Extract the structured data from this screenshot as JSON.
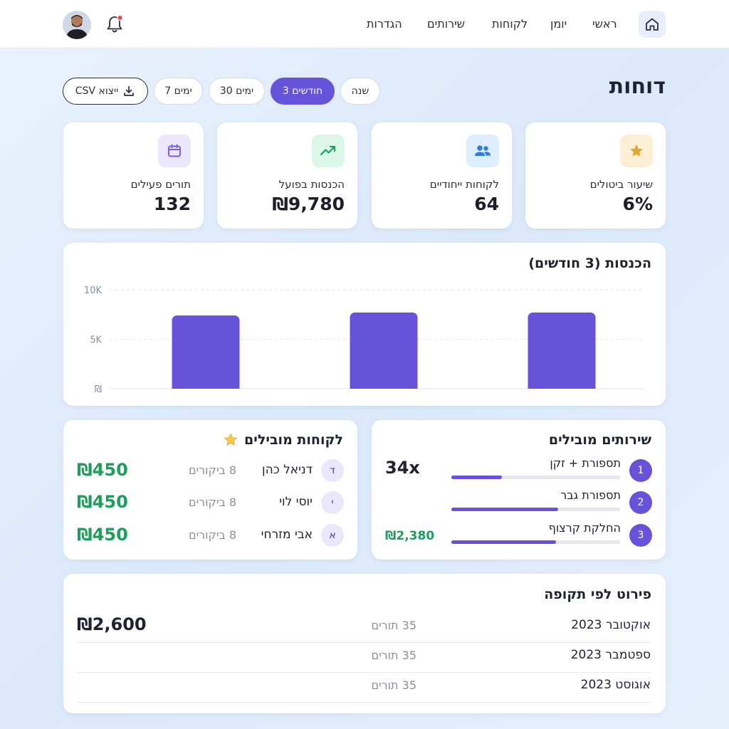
{
  "nav": {
    "items": [
      "ראשי",
      "יומן",
      "לקוחות",
      "שירותים",
      "הגדרות"
    ]
  },
  "page": {
    "title": "דוחות"
  },
  "filters": {
    "ranges": [
      "שנה",
      "3 חודשים",
      "30 ימים",
      "7 ימים"
    ],
    "active_index": 1,
    "export_label": "ייצוא CSV"
  },
  "kpis": [
    {
      "label": "שיעור ביטולים",
      "value": "6%",
      "icon": "star-icon",
      "icon_bg": "#fbefd6",
      "icon_color": "#e0a82e"
    },
    {
      "label": "לקוחות ייחודיים",
      "value": "64",
      "icon": "users-icon",
      "icon_bg": "#ddeefe",
      "icon_color": "#2f7fd8"
    },
    {
      "label": "הכנסות בפועל",
      "value": "₪9,780",
      "icon": "trending-up-icon",
      "icon_bg": "#dcf6e8",
      "icon_color": "#1f9d5c"
    },
    {
      "label": "תורים פעילים",
      "value": "132",
      "icon": "calendar-icon",
      "icon_bg": "#ece6fd",
      "icon_color": "#7c5ce0"
    }
  ],
  "revenue_chart": {
    "title": "הכנסות (3 חודשים)"
  },
  "chart_data": {
    "type": "bar",
    "title": "הכנסות (3 חודשים)",
    "categories": [
      "",
      "",
      ""
    ],
    "values": [
      7400,
      7700,
      7700
    ],
    "y_ticks": [
      "10K",
      "5K",
      "₪"
    ],
    "ylim": [
      0,
      10000
    ],
    "grid": true,
    "bar_color": "#6753d9"
  },
  "top_services": {
    "title": "שירותים מובילים",
    "items": [
      {
        "rank": "1",
        "name": "תספורת + זקן",
        "value": "34x",
        "progress": 0.3
      },
      {
        "rank": "2",
        "name": "תספורת גבר",
        "value": "",
        "progress": 0.635
      },
      {
        "rank": "3",
        "name": "החלקת קרצוף",
        "value": "₪2,380",
        "progress": 0.62
      }
    ]
  },
  "top_clients": {
    "title": "לקוחות מובילים",
    "title_icon": "star-icon",
    "items": [
      {
        "initial": "ד",
        "name": "דניאל כהן",
        "visits": "8 ביקורים",
        "amount": "₪450"
      },
      {
        "initial": "י",
        "name": "יוסי לוי",
        "visits": "8 ביקורים",
        "amount": "₪450"
      },
      {
        "initial": "א",
        "name": "אבי מזרחי",
        "visits": "8 ביקורים",
        "amount": "₪450"
      }
    ]
  },
  "breakdown": {
    "title": "פירוט לפי תקופה",
    "rows": [
      {
        "period": "אוקטובר 2023",
        "appointments": "35 תורים",
        "amount": "₪2,600"
      },
      {
        "period": "ספטמבר 2023",
        "appointments": "35 תורים",
        "amount": ""
      },
      {
        "period": "אוגוסט 2023",
        "appointments": "35 תורים",
        "amount": ""
      }
    ]
  },
  "colors": {
    "accent": "#6753d9",
    "positive": "#1f9d5c",
    "notification": "#e5484d"
  }
}
